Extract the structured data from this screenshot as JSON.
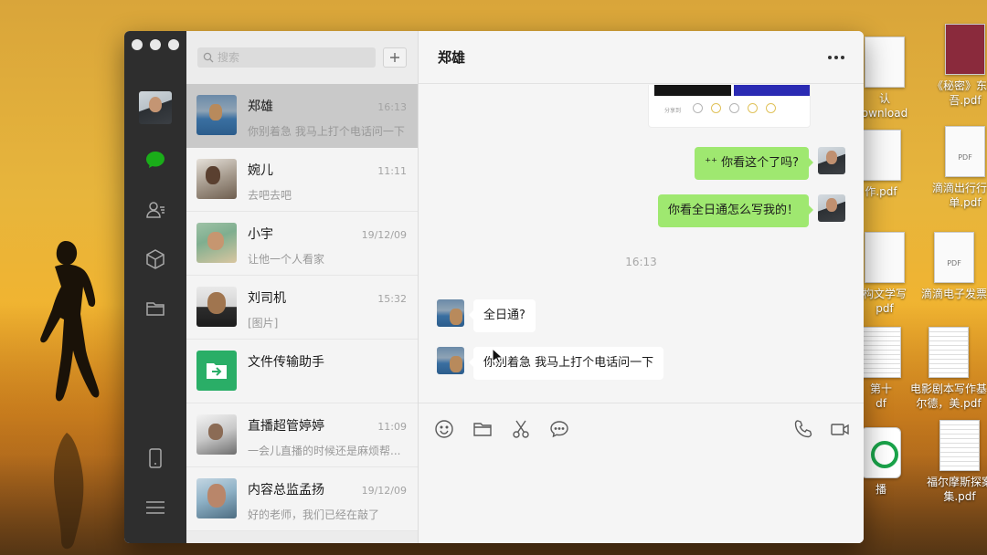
{
  "desktop": {
    "icons": [
      {
        "label": "《秘密》东野\n吾.pdf",
        "style": "book"
      },
      {
        "label": "认\nownload",
        "style": "doc"
      },
      {
        "label": "作.pdf",
        "style": "doc"
      },
      {
        "label": "滴滴出行行程\n单.pdf",
        "style": "doc"
      },
      {
        "label": "构文学写\npdf",
        "style": "doc"
      },
      {
        "label": "滴滴电子发票",
        "style": "doc"
      },
      {
        "label": "第十\ndf",
        "style": "lines"
      },
      {
        "label": "电影剧本写作基\n尔德，美.pdf",
        "style": "lines"
      },
      {
        "label": "播",
        "style": "green"
      },
      {
        "label": "福尔摩斯探案\n集.pdf",
        "style": "lines"
      }
    ],
    "doc_tag": "PDF"
  },
  "window": {
    "search": {
      "placeholder": "搜索"
    },
    "chats": [
      {
        "name": "郑雄",
        "time": "16:13",
        "preview": "你别着急 我马上打个电话问一下",
        "avatar": "av-zheng",
        "active": true
      },
      {
        "name": "婉儿",
        "time": "11:11",
        "preview": "去吧去吧",
        "avatar": "av-wan",
        "active": false
      },
      {
        "name": "小宇",
        "time": "19/12/09",
        "preview": "让他一个人看家",
        "avatar": "av-xiao",
        "active": false
      },
      {
        "name": "刘司机",
        "time": "15:32",
        "preview": "[图片]",
        "avatar": "av-liu",
        "active": false
      },
      {
        "name": "文件传输助手",
        "time": "",
        "preview": "",
        "avatar": "av-file",
        "active": false
      },
      {
        "name": "直播超管婷婷",
        "time": "11:09",
        "preview": "一会儿直播的时候还是麻烦帮...",
        "avatar": "av-zhibo",
        "active": false
      },
      {
        "name": "内容总监孟扬",
        "time": "19/12/09",
        "preview": "好的老师，我们已经在敲了",
        "avatar": "av-meng",
        "active": false
      }
    ],
    "conversation": {
      "title": "郑雄",
      "card_label": "分享到",
      "messages": [
        {
          "side": "right",
          "text": "⁺⁺ 你看这个了吗?"
        },
        {
          "side": "right",
          "text": "你看全日通怎么写我的！"
        },
        {
          "side": "left",
          "text": "全日通?"
        },
        {
          "side": "left",
          "text": "你别着急 我马上打个电话问一下"
        }
      ],
      "timestamp": "16:13"
    }
  },
  "colors": {
    "rail_bg": "#2e2e2e",
    "accent_green": "#1aad19",
    "bubble_green": "#9fe870",
    "file_helper": "#2aae67"
  }
}
